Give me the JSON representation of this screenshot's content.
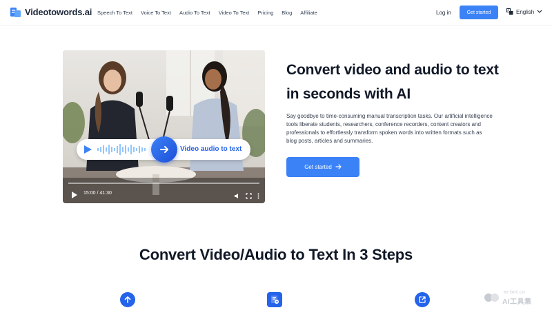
{
  "nav": {
    "logo_text": "Videotowords.ai",
    "links": [
      "Speech To Text",
      "Voice To Text",
      "Audio To Text",
      "Video To Text",
      "Pricing",
      "Blog",
      "Affiliate"
    ],
    "login_label": "Log in",
    "cta_label": "Get started",
    "language_label": "English"
  },
  "hero": {
    "title": "Convert video and audio to text in seconds with AI",
    "description": "Say goodbye to time-consuming manual transcription tasks. Our artificial intelligence tools liberate students, researchers, conference recorders, content creators and professionals to effortlessly transform spoken words into written formats such as blog posts, articles and summaries.",
    "cta_label": "Get started"
  },
  "video": {
    "pill_label": "Video audio to text",
    "time_label": "15:00 / 41:30"
  },
  "steps": {
    "title": "Convert Video/Audio to Text In 3 Steps",
    "icons": [
      "upload-icon",
      "file-convert-icon",
      "export-icon"
    ]
  },
  "watermark": {
    "line1": "ai-bot.cn",
    "line2": "AI工具集"
  },
  "colors": {
    "accent": "#3b82f6",
    "accent_dark": "#2563eb",
    "text_dark": "#111827"
  }
}
